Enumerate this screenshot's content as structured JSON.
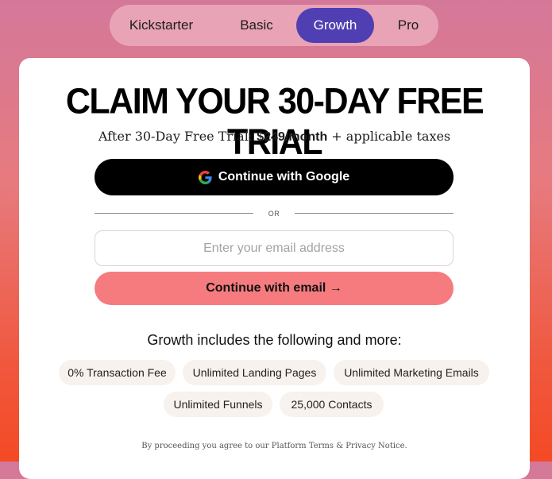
{
  "plans": {
    "tabs": [
      {
        "label": "Kickstarter"
      },
      {
        "label": "Basic"
      },
      {
        "label": "Growth",
        "active": true
      },
      {
        "label": "Pro"
      }
    ]
  },
  "trial": {
    "title": "CLAIM YOUR 30-DAY FREE TRIAL",
    "subtitle_prefix": "After 30-Day Free Trial: ",
    "price": "$249/month",
    "subtitle_suffix": " + applicable taxes"
  },
  "auth": {
    "google_label": "Continue with Google",
    "divider_text": "OR",
    "email_placeholder": "Enter your email address",
    "email_value": "",
    "email_button_label": "Continue with email →"
  },
  "features": {
    "heading": "Growth includes the following and more:",
    "chips": [
      "0% Transaction Fee",
      "Unlimited Landing Pages",
      "Unlimited Marketing Emails",
      "Unlimited Funnels",
      "25,000 Contacts"
    ]
  },
  "legal": {
    "text": "By proceeding you agree to our Platform Terms & Privacy Notice."
  },
  "colors": {
    "active_tab": "#4f3fb2",
    "email_button": "#f57b7f",
    "google_button": "#000000"
  },
  "icons": {
    "google": "google-g-icon",
    "arrow": "arrow-right-icon"
  }
}
